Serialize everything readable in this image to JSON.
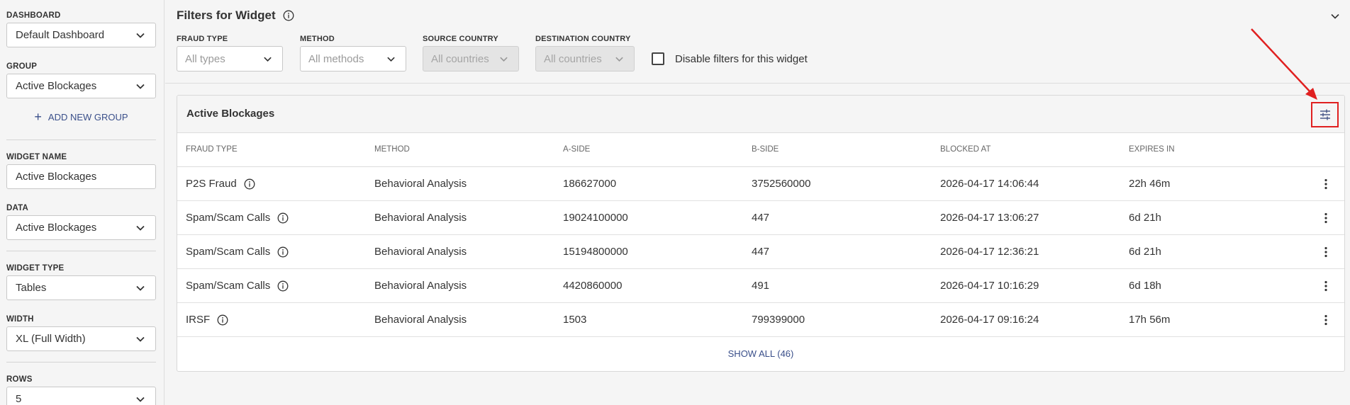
{
  "sidebar": {
    "dashboard": {
      "label": "DASHBOARD",
      "value": "Default Dashboard"
    },
    "group": {
      "label": "GROUP",
      "value": "Active Blockages"
    },
    "add_group_label": "ADD NEW GROUP",
    "widget_name": {
      "label": "WIDGET NAME",
      "value": "Active Blockages"
    },
    "data": {
      "label": "DATA",
      "value": "Active Blockages"
    },
    "widget_type": {
      "label": "WIDGET TYPE",
      "value": "Tables"
    },
    "width": {
      "label": "WIDTH",
      "value": "XL (Full Width)"
    },
    "rows": {
      "label": "ROWS",
      "value": "5"
    }
  },
  "filters": {
    "title": "Filters for Widget",
    "fraud_type": {
      "label": "FRAUD TYPE",
      "placeholder": "All types"
    },
    "method": {
      "label": "METHOD",
      "placeholder": "All methods"
    },
    "source_country": {
      "label": "SOURCE COUNTRY",
      "placeholder": "All countries"
    },
    "destination_country": {
      "label": "DESTINATION COUNTRY",
      "placeholder": "All countries"
    },
    "disable_label": "Disable filters for this widget"
  },
  "card": {
    "title": "Active Blockages",
    "columns": [
      "FRAUD TYPE",
      "METHOD",
      "A-SIDE",
      "B-SIDE",
      "BLOCKED AT",
      "EXPIRES IN"
    ],
    "rows": [
      {
        "fraud_type": "P2S Fraud",
        "method": "Behavioral Analysis",
        "a_side": "186627000",
        "b_side": "3752560000",
        "blocked_at": "2026-04-17 14:06:44",
        "expires_in": "22h 46m"
      },
      {
        "fraud_type": "Spam/Scam Calls",
        "method": "Behavioral Analysis",
        "a_side": "19024100000",
        "b_side": "447",
        "blocked_at": "2026-04-17 13:06:27",
        "expires_in": "6d 21h"
      },
      {
        "fraud_type": "Spam/Scam Calls",
        "method": "Behavioral Analysis",
        "a_side": "15194800000",
        "b_side": "447",
        "blocked_at": "2026-04-17 12:36:21",
        "expires_in": "6d 21h"
      },
      {
        "fraud_type": "Spam/Scam Calls",
        "method": "Behavioral Analysis",
        "a_side": "4420860000",
        "b_side": "491",
        "blocked_at": "2026-04-17 10:16:29",
        "expires_in": "6d 18h"
      },
      {
        "fraud_type": "IRSF",
        "method": "Behavioral Analysis",
        "a_side": "1503",
        "b_side": "799399000",
        "blocked_at": "2026-04-17 09:16:24",
        "expires_in": "17h 56m"
      }
    ],
    "show_all_label": "SHOW ALL (46)"
  },
  "colors": {
    "accent_link": "#3a4f8a",
    "highlight": "#e02020"
  }
}
